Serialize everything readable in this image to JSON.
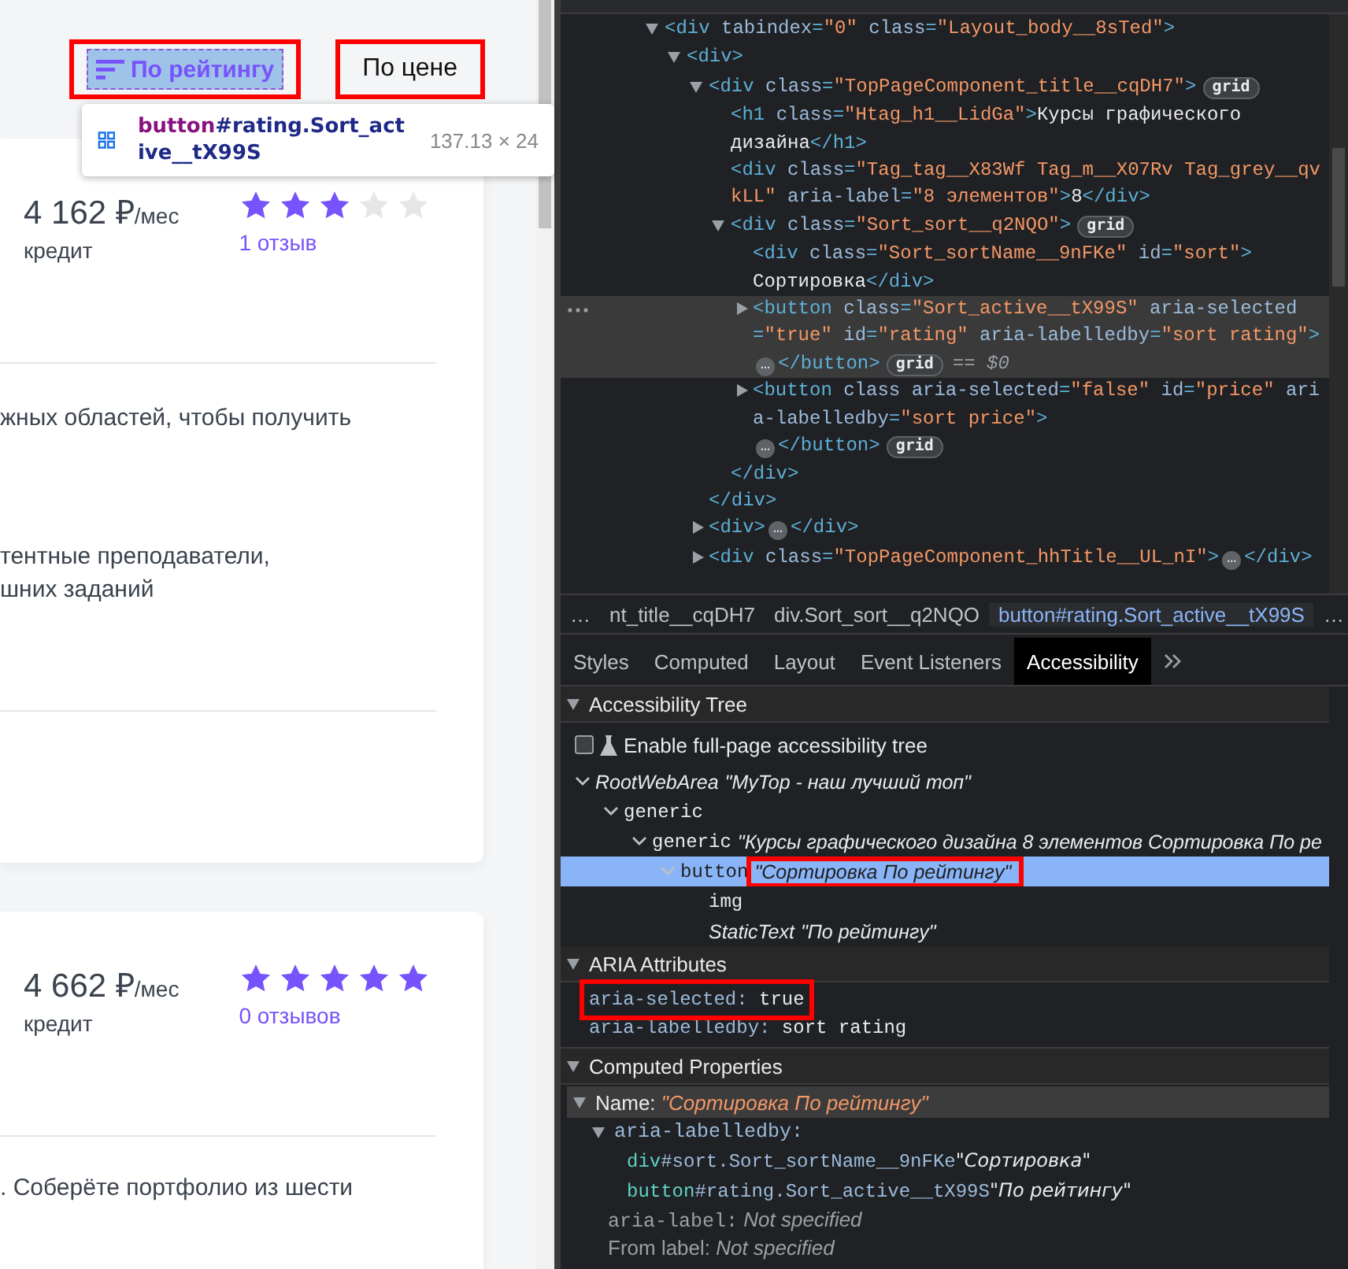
{
  "page": {
    "sort_buttons": [
      {
        "label": "По рейтингу",
        "icon": true,
        "selected": true,
        "inspected": true
      },
      {
        "label": "По цене",
        "icon": false,
        "selected": false,
        "inspected": false
      }
    ],
    "inspect_tooltip": {
      "tag": "button",
      "selector": "#rating.Sort_active__tX99S",
      "size": "137.13 × 24"
    },
    "cards": [
      {
        "price": "4 162 ₽",
        "unit": "/мес",
        "price_note": "кредит",
        "stars": 3,
        "reviews": "1 отзыв",
        "paragraphs": [
          {
            "lines": [
              "жных областей, чтобы получить"
            ]
          },
          {
            "lines": [
              "тентные преподаватели,",
              "шних заданий"
            ]
          }
        ]
      },
      {
        "price": "4 662 ₽",
        "unit": "/мес",
        "price_note": "кредит",
        "stars": 5,
        "reviews": "0 отзывов",
        "paragraphs": [
          {
            "lines": [
              ". Соберёте портфолио из шести"
            ]
          }
        ]
      }
    ]
  },
  "devtools": {
    "dom_tree": [
      {
        "expanded": true,
        "selected": false,
        "parts": [
          {
            "kind": "tag",
            "t": "<div "
          },
          {
            "kind": "attr",
            "t": "tabindex"
          },
          {
            "kind": "tag",
            "t": "="
          },
          {
            "kind": "val",
            "t": "\"0\""
          },
          {
            "kind": "attr",
            "t": " class"
          },
          {
            "kind": "tag",
            "t": "="
          },
          {
            "kind": "val",
            "t": "\"Layout_body__8sTed\""
          },
          {
            "kind": "tag",
            "t": ">"
          }
        ],
        "children": [
          {
            "expanded": true,
            "selected": false,
            "parts": [
              {
                "kind": "tag",
                "t": "<div>"
              }
            ],
            "children": [
              {
                "expanded": true,
                "selected": false,
                "parts": [
                  {
                    "kind": "tag",
                    "t": "<div "
                  },
                  {
                    "kind": "attr",
                    "t": "class"
                  },
                  {
                    "kind": "tag",
                    "t": "="
                  },
                  {
                    "kind": "val",
                    "t": "\"TopPageComponent_title__cqDH7\""
                  },
                  {
                    "kind": "tag",
                    "t": ">"
                  },
                  {
                    "kind": "badge",
                    "t": "grid"
                  }
                ],
                "closing": "</div>",
                "children": [
                  {
                    "parts": [
                      {
                        "kind": "tag",
                        "t": "<h1 "
                      },
                      {
                        "kind": "attr",
                        "t": "class"
                      },
                      {
                        "kind": "tag",
                        "t": "="
                      },
                      {
                        "kind": "val",
                        "t": "\"Htag_h1__LidGa\""
                      },
                      {
                        "kind": "tag",
                        "t": ">"
                      },
                      {
                        "kind": "text",
                        "t": "Курсы графического дизайна"
                      },
                      {
                        "kind": "tag",
                        "t": "</h1>"
                      }
                    ],
                    "selected": false
                  },
                  {
                    "parts": [
                      {
                        "kind": "tag",
                        "t": "<div "
                      },
                      {
                        "kind": "attr",
                        "t": "class"
                      },
                      {
                        "kind": "tag",
                        "t": "="
                      },
                      {
                        "kind": "val",
                        "t": "\"Tag_tag__X83Wf Tag_m__X07Rv Tag_grey__qvkLL\""
                      },
                      {
                        "kind": "attr",
                        "t": " aria-label"
                      },
                      {
                        "kind": "tag",
                        "t": "="
                      },
                      {
                        "kind": "val",
                        "t": "\"8 элементов\""
                      },
                      {
                        "kind": "tag",
                        "t": ">"
                      },
                      {
                        "kind": "text",
                        "t": "8"
                      },
                      {
                        "kind": "tag",
                        "t": "</div>"
                      }
                    ],
                    "selected": false
                  },
                  {
                    "expanded": true,
                    "selected": false,
                    "parts": [
                      {
                        "kind": "tag",
                        "t": "<div "
                      },
                      {
                        "kind": "attr",
                        "t": "class"
                      },
                      {
                        "kind": "tag",
                        "t": "="
                      },
                      {
                        "kind": "val",
                        "t": "\"Sort_sort__q2NQO\""
                      },
                      {
                        "kind": "tag",
                        "t": ">"
                      },
                      {
                        "kind": "badge",
                        "t": "grid"
                      }
                    ],
                    "closing": "</div>",
                    "children": [
                      {
                        "selected": false,
                        "parts": [
                          {
                            "kind": "tag",
                            "t": "<div "
                          },
                          {
                            "kind": "attr",
                            "t": "class"
                          },
                          {
                            "kind": "tag",
                            "t": "="
                          },
                          {
                            "kind": "val",
                            "t": "\"Sort_sortName__9nFKe\""
                          },
                          {
                            "kind": "attr",
                            "t": " id"
                          },
                          {
                            "kind": "tag",
                            "t": "="
                          },
                          {
                            "kind": "val",
                            "t": "\"sort\""
                          },
                          {
                            "kind": "tag",
                            "t": ">"
                          },
                          {
                            "kind": "text",
                            "t": "Сортировка"
                          },
                          {
                            "kind": "tag",
                            "t": "</div>"
                          }
                        ]
                      },
                      {
                        "expanded": false,
                        "selected": true,
                        "parts": [
                          {
                            "kind": "tag",
                            "t": "<button "
                          },
                          {
                            "kind": "attr",
                            "t": "class"
                          },
                          {
                            "kind": "tag",
                            "t": "="
                          },
                          {
                            "kind": "val",
                            "t": "\"Sort_active__tX99S\""
                          },
                          {
                            "kind": "attr",
                            "t": " aria-selected"
                          },
                          {
                            "kind": "tag",
                            "t": "="
                          },
                          {
                            "kind": "val",
                            "t": "\"true\""
                          },
                          {
                            "kind": "attr",
                            "t": " id"
                          },
                          {
                            "kind": "tag",
                            "t": "="
                          },
                          {
                            "kind": "val",
                            "t": "\"rating\""
                          },
                          {
                            "kind": "attr",
                            "t": " aria-labelledby"
                          },
                          {
                            "kind": "tag",
                            "t": "="
                          },
                          {
                            "kind": "val",
                            "t": "\"sort rating\""
                          },
                          {
                            "kind": "tag",
                            "t": ">"
                          },
                          {
                            "kind": "ellipsis",
                            "t": "…"
                          },
                          {
                            "kind": "tag",
                            "t": "</button>"
                          },
                          {
                            "kind": "badge",
                            "t": "grid"
                          },
                          {
                            "kind": "ref",
                            "t": "== $0"
                          }
                        ]
                      },
                      {
                        "expanded": false,
                        "selected": false,
                        "parts": [
                          {
                            "kind": "tag",
                            "t": "<button "
                          },
                          {
                            "kind": "attr",
                            "t": "class aria-selected"
                          },
                          {
                            "kind": "tag",
                            "t": "="
                          },
                          {
                            "kind": "val",
                            "t": "\"false\""
                          },
                          {
                            "kind": "attr",
                            "t": " id"
                          },
                          {
                            "kind": "tag",
                            "t": "="
                          },
                          {
                            "kind": "val",
                            "t": "\"price\""
                          },
                          {
                            "kind": "attr",
                            "t": " aria-labelledby"
                          },
                          {
                            "kind": "tag",
                            "t": "="
                          },
                          {
                            "kind": "val",
                            "t": "\"sort price\""
                          },
                          {
                            "kind": "tag",
                            "t": ">"
                          },
                          {
                            "kind": "ellipsis",
                            "t": "…"
                          },
                          {
                            "kind": "tag",
                            "t": "</button>"
                          },
                          {
                            "kind": "badge",
                            "t": "grid"
                          }
                        ]
                      }
                    ]
                  }
                ]
              },
              {
                "expanded": false,
                "selected": false,
                "parts": [
                  {
                    "kind": "tag",
                    "t": "<div>"
                  },
                  {
                    "kind": "ellipsis",
                    "t": "…"
                  },
                  {
                    "kind": "tag",
                    "t": "</div>"
                  }
                ]
              },
              {
                "expanded": false,
                "selected": false,
                "parts": [
                  {
                    "kind": "tag",
                    "t": "<div "
                  },
                  {
                    "kind": "attr",
                    "t": "class"
                  },
                  {
                    "kind": "tag",
                    "t": "="
                  },
                  {
                    "kind": "val",
                    "t": "\"TopPageComponent_hhTitle__UL_nI\""
                  },
                  {
                    "kind": "tag",
                    "t": ">"
                  },
                  {
                    "kind": "ellipsis",
                    "t": "…"
                  },
                  {
                    "kind": "tag",
                    "t": "</div>"
                  }
                ]
              }
            ]
          }
        ]
      }
    ],
    "breadcrumbs": [
      {
        "label": "…",
        "selected": false
      },
      {
        "label": "nt_title__cqDH7",
        "selected": false
      },
      {
        "label": "div.Sort_sort__q2NQO",
        "selected": false
      },
      {
        "label": "button#rating.Sort_active__tX99S",
        "selected": true
      },
      {
        "label": "…",
        "selected": false
      }
    ],
    "tabs": [
      {
        "label": "Styles",
        "selected": false
      },
      {
        "label": "Computed",
        "selected": false
      },
      {
        "label": "Layout",
        "selected": false
      },
      {
        "label": "Event Listeners",
        "selected": false
      },
      {
        "label": "Accessibility",
        "selected": true
      }
    ],
    "accessibility_tree": {
      "title": "Accessibility Tree",
      "checkbox": {
        "label": "Enable full-page accessibility tree",
        "checked": false
      },
      "nodes": [
        {
          "role": "RootWebArea",
          "name": "\"MyTop - наш лучший топ\"",
          "expanded": true,
          "selected": false,
          "children": [
            {
              "role": "generic",
              "expanded": true,
              "selected": false,
              "children": [
                {
                  "role": "generic",
                  "name": "\"Курсы графического дизайна 8 элементов Сортировка По ре",
                  "expanded": true,
                  "selected": false,
                  "children": [
                    {
                      "role": "button",
                      "name": "\"Сортировка По рейтингу\"",
                      "expanded": true,
                      "selected": true,
                      "annotated": true,
                      "children": [
                        {
                          "role": "img",
                          "selected": false
                        },
                        {
                          "role": "StaticText",
                          "name": "\"По рейтингу\"",
                          "selected": false
                        }
                      ]
                    }
                  ]
                }
              ]
            }
          ]
        }
      ]
    },
    "aria_attributes": {
      "title": "ARIA Attributes",
      "items": [
        {
          "name": "aria-selected:",
          "value": "true",
          "annotated": true
        },
        {
          "name": "aria-labelledby:",
          "value": "sort rating",
          "annotated": false
        }
      ]
    },
    "computed_properties": {
      "title": "Computed Properties",
      "name_label": "Name:",
      "name_value": "\"Сортировка По рейтингу\"",
      "labelledby": "aria-labelledby:",
      "sources": [
        {
          "tag": "div",
          "selector": "#sort.Sort_sortName__9nFKe",
          "text": "\"Сортировка\""
        },
        {
          "tag": "button",
          "selector": "#rating.Sort_active__tX99S",
          "text": "\"По рейтингу\""
        }
      ],
      "other": [
        {
          "label": "aria-label:",
          "value": "Not specified"
        },
        {
          "label": "From label:",
          "value": "Not specified"
        }
      ]
    }
  }
}
